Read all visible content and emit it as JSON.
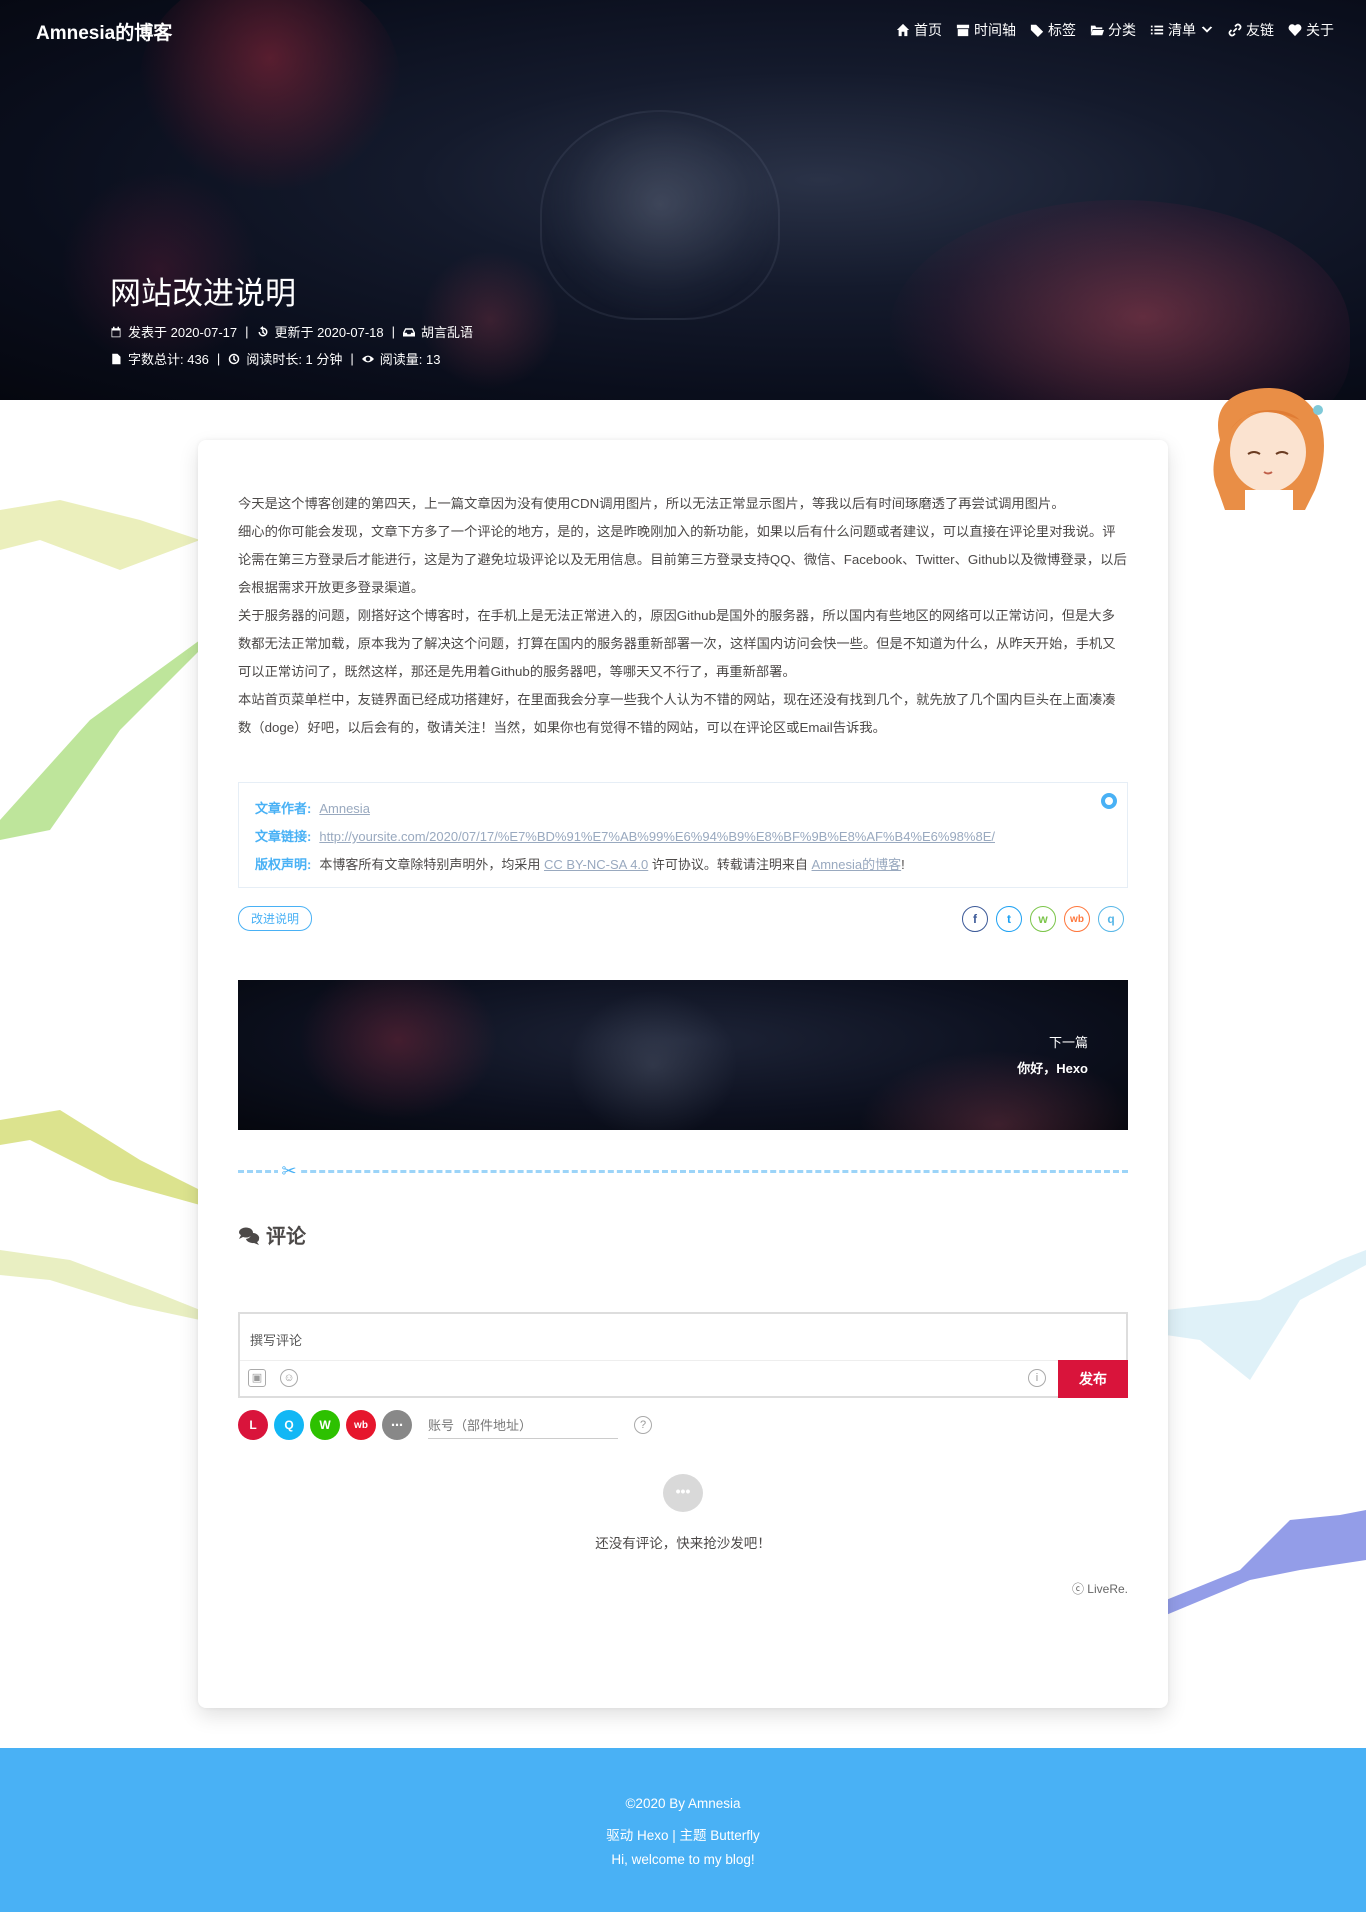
{
  "header": {
    "site_name": "Amnesia的博客",
    "nav": [
      {
        "label": "首页",
        "icon": "home-icon"
      },
      {
        "label": "时间轴",
        "icon": "archive-icon"
      },
      {
        "label": "标签",
        "icon": "tags-icon"
      },
      {
        "label": "分类",
        "icon": "folder-open-icon"
      },
      {
        "label": "清单",
        "icon": "list-icon"
      },
      {
        "label": "友链",
        "icon": "link-icon"
      },
      {
        "label": "关于",
        "icon": "heart-icon"
      }
    ]
  },
  "post": {
    "title": "网站改进说明",
    "published": "发表于 2020-07-17",
    "updated": "更新于 2020-07-18",
    "category": "胡言乱语",
    "word_count": "字数总计: 436",
    "read_time": "阅读时长: 1 分钟",
    "views": "阅读量: 13",
    "paragraphs": [
      "今天是这个博客创建的第四天，上一篇文章因为没有使用CDN调用图片，所以无法正常显示图片，等我以后有时间琢磨透了再尝试调用图片。",
      "细心的你可能会发现，文章下方多了一个评论的地方，是的，这是昨晚刚加入的新功能，如果以后有什么问题或者建议，可以直接在评论里对我说。评论需在第三方登录后才能进行，这是为了避免垃圾评论以及无用信息。目前第三方登录支持QQ、微信、Facebook、Twitter、Github以及微博登录，以后会根据需求开放更多登录渠道。",
      "关于服务器的问题，刚搭好这个博客时，在手机上是无法正常进入的，原因Github是国外的服务器，所以国内有些地区的网络可以正常访问，但是大多数都无法正常加载，原本我为了解决这个问题，打算在国内的服务器重新部署一次，这样国内访问会快一些。但是不知道为什么，从昨天开始，手机又可以正常访问了，既然这样，那还是先用着Github的服务器吧，等哪天又不行了，再重新部署。",
      "本站首页菜单栏中，友链界面已经成功搭建好，在里面我会分享一些我个人认为不错的网站，现在还没有找到几个，就先放了几个国内巨头在上面凑凑数（doge）好吧，以后会有的，敬请关注！当然，如果你也有觉得不错的网站，可以在评论区或Email告诉我。"
    ]
  },
  "copyright": {
    "author_label": "文章作者:",
    "author": "Amnesia",
    "link_label": "文章链接:",
    "link": "http://yoursite.com/2020/07/17/%E7%BD%91%E7%AB%99%E6%94%B9%E8%BF%9B%E8%AF%B4%E6%98%8E/",
    "license_label": "版权声明:",
    "license_prefix": "本博客所有文章除特别声明外，均采用",
    "license_name": "CC BY-NC-SA 4.0",
    "license_middle": "许可协议。转载请注明来自",
    "license_site": "Amnesia的博客",
    "license_suffix": "!"
  },
  "tag": "改进说明",
  "share": [
    {
      "name": "facebook-share-icon",
      "glyph": "f",
      "color": "#3b5998"
    },
    {
      "name": "twitter-share-icon",
      "glyph": "t",
      "color": "#1da1f2"
    },
    {
      "name": "wechat-share-icon",
      "glyph": "w",
      "color": "#7bc549"
    },
    {
      "name": "weibo-share-icon",
      "glyph": "wb",
      "color": "#ff763b"
    },
    {
      "name": "qq-share-icon",
      "glyph": "q",
      "color": "#56b6e7"
    }
  ],
  "next_post": {
    "label": "下一篇",
    "title": "你好，Hexo"
  },
  "comments": {
    "title": "评论",
    "placeholder": "撰写评论",
    "publish": "发布",
    "account_placeholder": "账号（部件地址）",
    "empty": "还没有评论，快来抢沙发吧！",
    "provider": "ⓒ LiveRe."
  },
  "login_providers": [
    {
      "name": "livere-login-icon",
      "glyph": "L",
      "color": "#d9143b"
    },
    {
      "name": "qq-login-icon",
      "glyph": "Q",
      "color": "#12b7f5"
    },
    {
      "name": "wechat-login-icon",
      "glyph": "W",
      "color": "#2dc100"
    },
    {
      "name": "weibo-login-icon",
      "glyph": "wb",
      "color": "#e6162d"
    },
    {
      "name": "more-login-icon",
      "glyph": "⋯",
      "color": "#888888"
    }
  ],
  "footer": {
    "copyright": "©2020 By Amnesia",
    "powered": "驱动 Hexo | 主题 Butterfly",
    "welcome": "Hi, welcome to my blog!"
  },
  "colors": {
    "accent": "#49b1f5",
    "publish": "#d9143b"
  }
}
